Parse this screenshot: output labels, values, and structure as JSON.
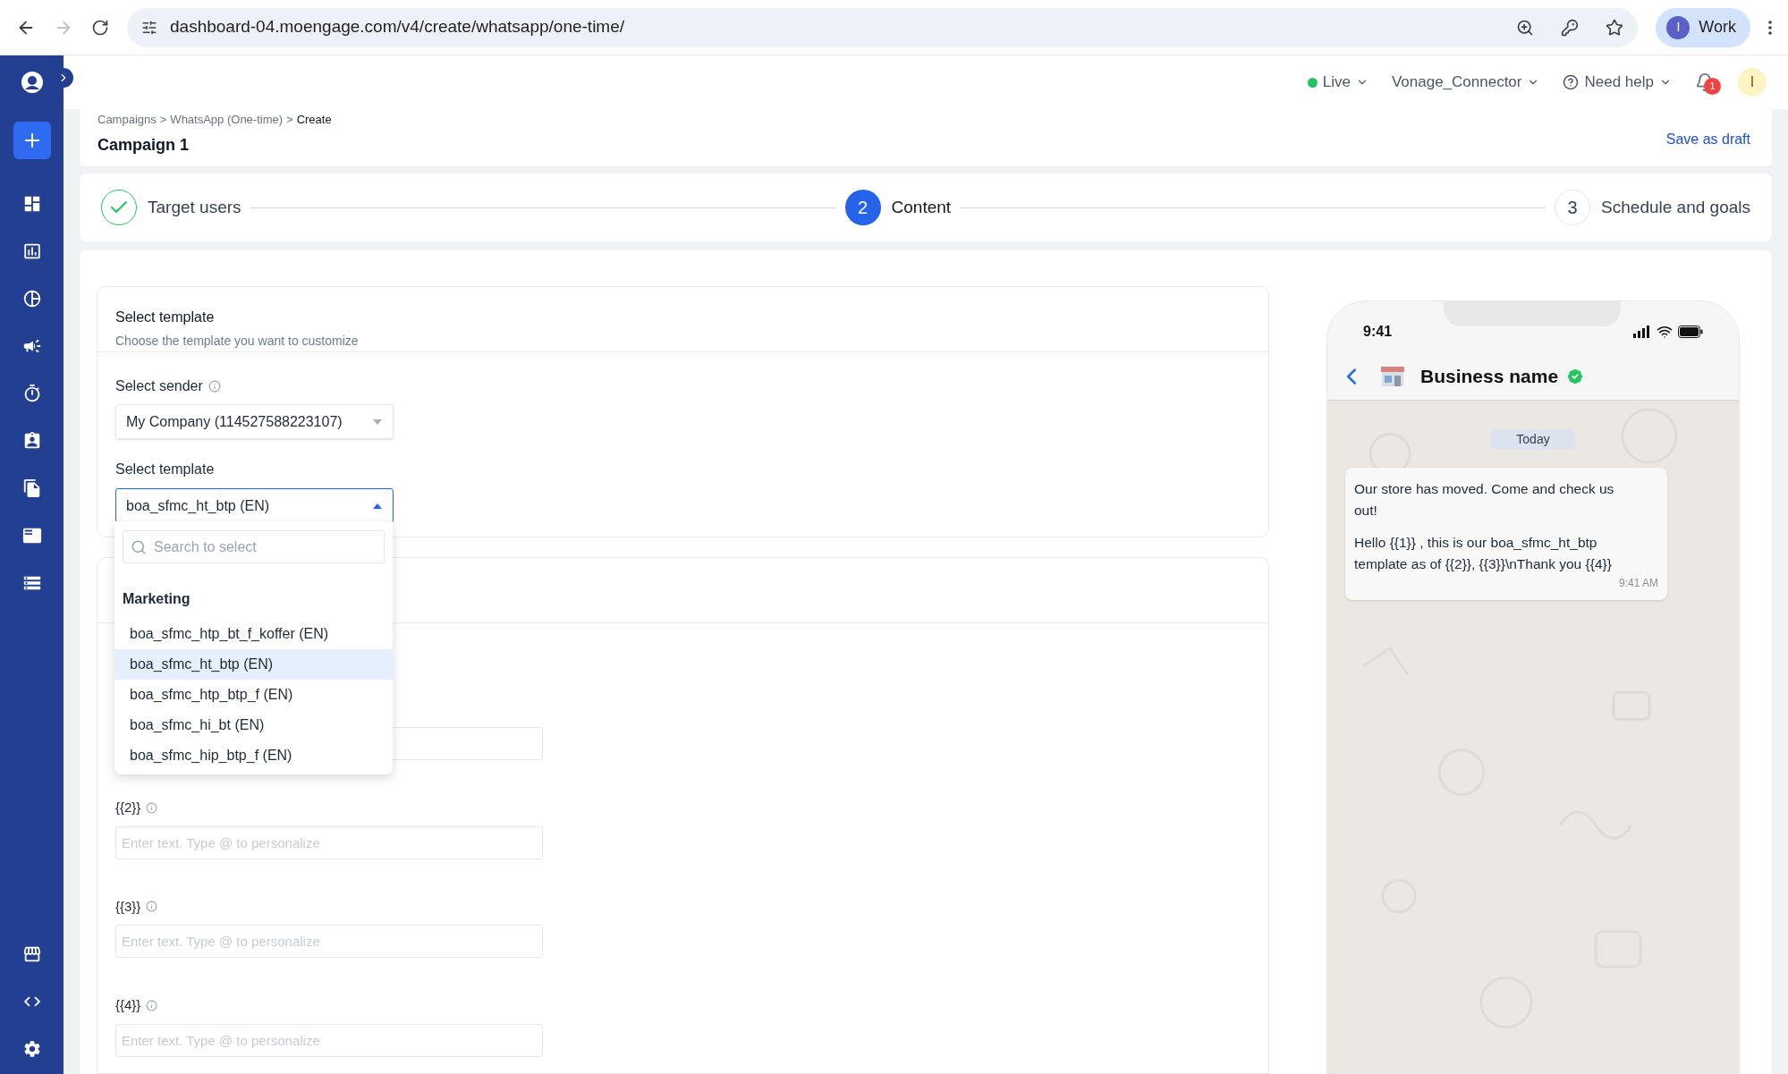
{
  "browser": {
    "back_enabled": true,
    "forward_enabled": false,
    "url": "dashboard-04.moengage.com/v4/create/whatsapp/one-time/",
    "profile": {
      "initial": "I",
      "label": "Work"
    }
  },
  "header": {
    "environment": {
      "label": "Live",
      "color": "#22c55e"
    },
    "workspace": "Vonage_Connector",
    "help": "Need help",
    "notifications": "1",
    "avatar": "I"
  },
  "breadcrumb": {
    "items": [
      "Campaigns",
      "WhatsApp (One-time)",
      "Create"
    ],
    "separator": ">"
  },
  "campaign": {
    "title": "Campaign 1",
    "save_label": "Save as draft"
  },
  "steps": [
    {
      "label": "Target users",
      "kind": "done"
    },
    {
      "label": "Content",
      "marker": "2",
      "kind": "active"
    },
    {
      "label": "Schedule and goals",
      "marker": "3",
      "kind": "pending"
    }
  ],
  "template_section": {
    "title": "Select template",
    "subtitle": "Choose the template you want to customize",
    "sender_label": "Select sender",
    "sender_value": "My Company (114527588223107)",
    "template_label": "Select template",
    "template_value": "boa_sfmc_ht_btp (EN)",
    "expanded": true
  },
  "dropdown": {
    "search_placeholder": "Search to select",
    "group": "Marketing",
    "options": [
      {
        "label": "boa_sfmc_htp_bt_f_koffer (EN)",
        "selected": false
      },
      {
        "label": "boa_sfmc_ht_btp (EN)",
        "selected": true
      },
      {
        "label": "boa_sfmc_htp_btp_f (EN)",
        "selected": false
      },
      {
        "label": "boa_sfmc_hi_bt (EN)",
        "selected": false
      },
      {
        "label": "boa_sfmc_hip_btp_f (EN)",
        "selected": false
      }
    ]
  },
  "variables": [
    {
      "label": "{{2}}",
      "placeholder": "Enter text. Type @ to personalize"
    },
    {
      "label": "{{3}}",
      "placeholder": "Enter text. Type @ to personalize"
    },
    {
      "label": "{{4}}",
      "placeholder": "Enter text. Type @ to personalize"
    }
  ],
  "preview": {
    "time": "9:41",
    "business_name": "Business name",
    "verified": true,
    "date_chip": "Today",
    "message": [
      "Our store has moved. Come and check us out!",
      "Hello {{1}} , this is our boa_sfmc_ht_btp template as of {{2}}, {{3}}\\nThank you {{4}}"
    ],
    "timestamp": "9:41 AM"
  }
}
